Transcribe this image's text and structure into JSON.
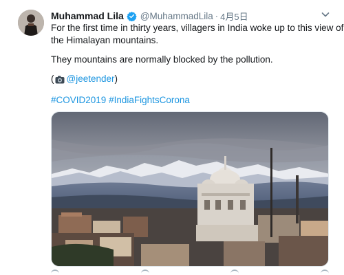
{
  "tweet": {
    "display_name": "Muhammad Lila",
    "handle": "@MuhammadLila",
    "separator": "·",
    "date": "4月5日",
    "text_line1": "For the first time in thirty years, villagers in India woke up to this view of",
    "text_line2": "the Himalayan mountains.",
    "text_line3": "They mountains are normally blocked by the pollution.",
    "credit_open": "(",
    "credit_mention": "@jeetender",
    "credit_close": ")",
    "hashtags": [
      "#COVID2019",
      "#IndiaFightsCorona"
    ]
  },
  "icons": {
    "verified": "verified-badge-icon",
    "caret": "chevron-down-icon",
    "camera": "camera-icon"
  },
  "colors": {
    "link": "#1b95e0",
    "verified": "#1da1f2",
    "muted": "#657786",
    "text": "#14171a"
  }
}
